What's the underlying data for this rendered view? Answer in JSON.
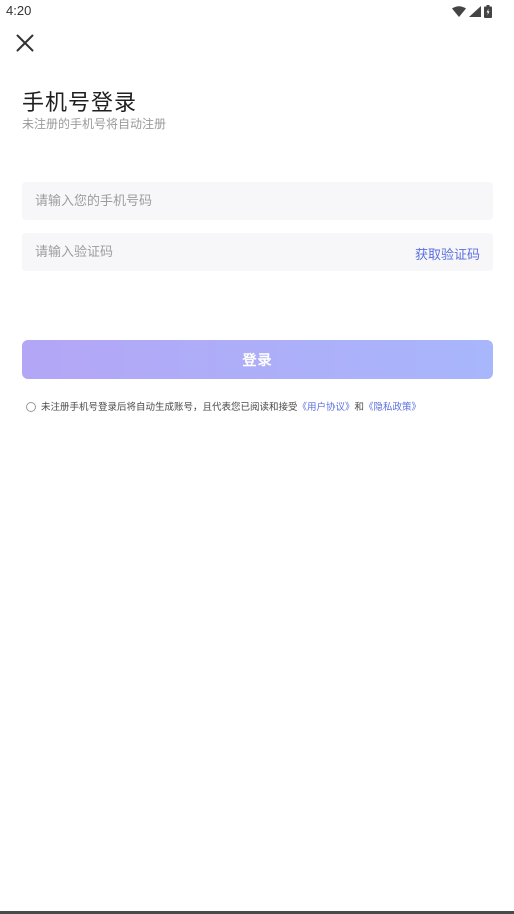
{
  "status_bar": {
    "time": "4:20",
    "icons": [
      "wifi-icon",
      "signal-icon",
      "battery-icon"
    ]
  },
  "header": {
    "close_icon": "close-icon"
  },
  "login": {
    "title": "手机号登录",
    "subtitle": "未注册的手机号将自动注册",
    "phone_placeholder": "请输入您的手机号码",
    "code_placeholder": "请输入验证码",
    "get_code_label": "获取验证码",
    "submit_label": "登录"
  },
  "agreement": {
    "text": "未注册手机号登录后将自动生成账号，且代表您已阅读和接受",
    "user_agreement": "《用户协议》",
    "connector": "和",
    "privacy_policy": "《隐私政策》"
  },
  "colors": {
    "accent": "#5b6fe0",
    "button_gradient_start": "#b3a6f6",
    "button_gradient_end": "#a8b6fb",
    "field_background": "#f7f7f9"
  }
}
